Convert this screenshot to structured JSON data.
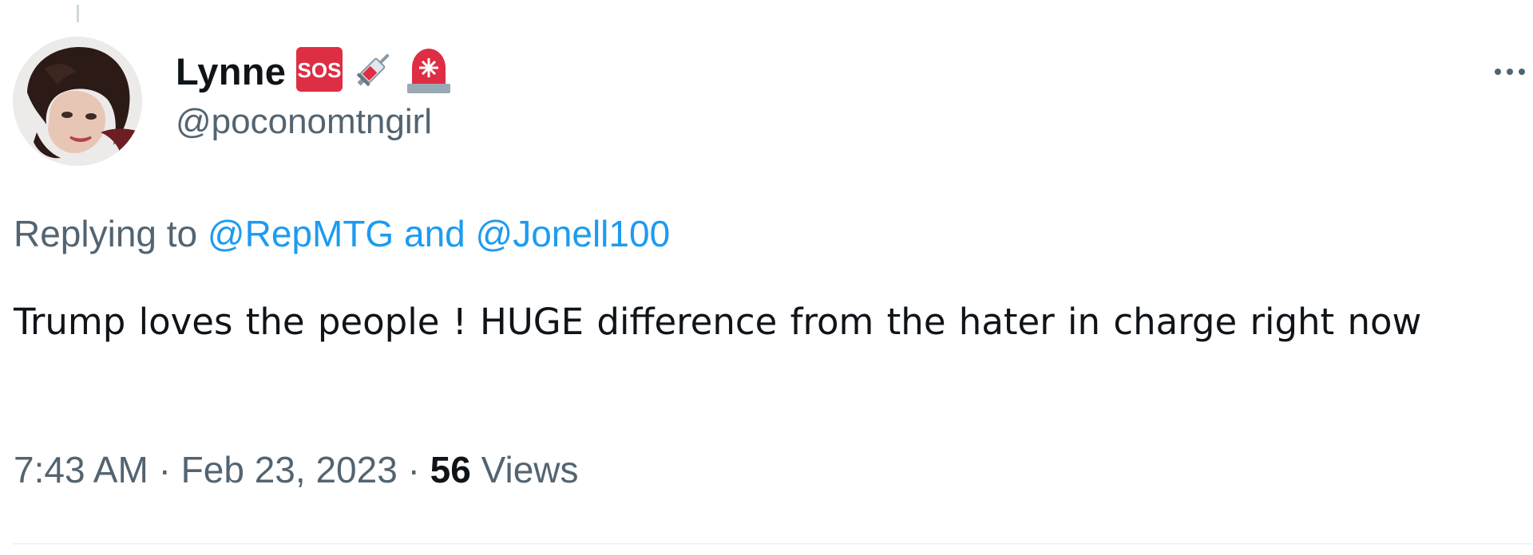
{
  "tweet": {
    "author": {
      "display_name": "Lynne",
      "emojis": [
        "sos-emoji-icon",
        "syringe-emoji-icon",
        "police-light-emoji-icon"
      ],
      "handle": "@poconomtngirl"
    },
    "reply": {
      "prefix": "Replying to",
      "mention_1": "@RepMTG",
      "conjunction": "and",
      "mention_2": "@Jonell100"
    },
    "text": "Trump loves the people ! HUGE difference from the hater in charge right now",
    "meta": {
      "time": "7:43 AM",
      "separator": "·",
      "date": "Feb 23, 2023",
      "views_count": "56",
      "views_label": "Views"
    }
  },
  "colors": {
    "primary_text": "#0f1419",
    "secondary_text": "#536471",
    "link": "#1d9bf0",
    "sos_badge": "#dd2e44",
    "divider": "#eff3f4"
  }
}
